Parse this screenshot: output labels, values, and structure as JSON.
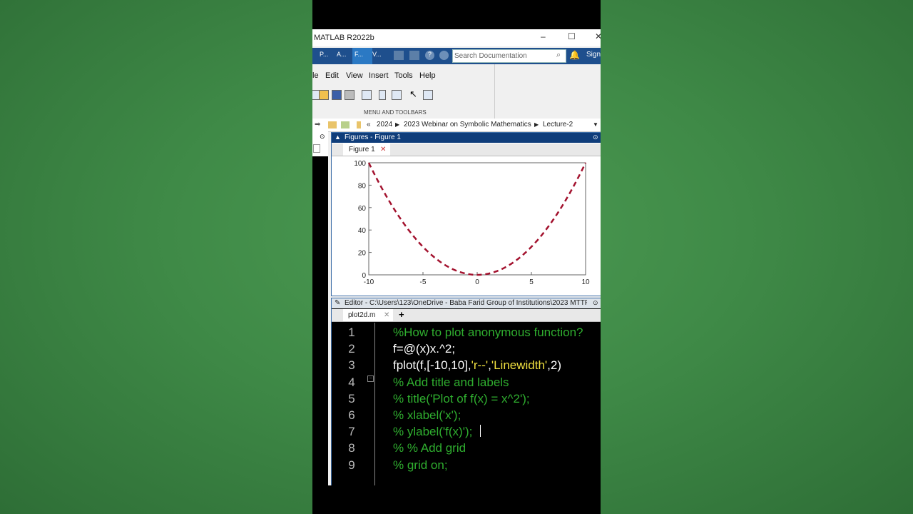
{
  "window": {
    "title": "MATLAB R2022b",
    "controls": {
      "minimize": "–",
      "maximize": "☐",
      "close": "✕"
    }
  },
  "ribbon": {
    "tabs": [
      "P...",
      "A...",
      "F...",
      "V..."
    ],
    "search_placeholder": "Search Documentation",
    "sign_in": "Sign"
  },
  "menu": {
    "items": [
      "le",
      "Edit",
      "View",
      "Insert",
      "Tools",
      "Help"
    ],
    "section_label": "MENU AND TOOLBARS"
  },
  "address": {
    "back": "«",
    "crumbs": [
      "2024",
      "2023 Webinar on Symbolic Mathematics",
      "Lecture-2"
    ]
  },
  "figure_panel": {
    "header": "Figures - Figure 1",
    "tab": "Figure 1"
  },
  "chart_data": {
    "type": "line",
    "function": "x.^2",
    "x_range": [
      -10,
      10
    ],
    "ylim": [
      0,
      100
    ],
    "xticks": [
      "-10",
      "-5",
      "0",
      "5",
      "10"
    ],
    "yticks": [
      "0",
      "20",
      "40",
      "60",
      "80",
      "100"
    ],
    "line_style": "dashed",
    "color": "#a3122e",
    "title": "",
    "xlabel": "",
    "ylabel": ""
  },
  "editor": {
    "header": "Editor - C:\\Users\\123\\OneDrive - Baba Farid Group of Institutions\\2023 MTTF...",
    "tab": "plot2d.m",
    "add_tab": "+",
    "lines": [
      {
        "num": "1",
        "parts": [
          {
            "t": "%How to plot anonymous function?",
            "c": "cmt"
          }
        ]
      },
      {
        "num": "2",
        "parts": [
          {
            "t": "f=@(x)x.^2;",
            "c": "plain"
          }
        ]
      },
      {
        "num": "3",
        "parts": [
          {
            "t": "fplot(f,[-10,10],",
            "c": "plain"
          },
          {
            "t": "'r--'",
            "c": "str"
          },
          {
            "t": ",",
            "c": "plain"
          },
          {
            "t": "'Linewidth'",
            "c": "str"
          },
          {
            "t": ",2)",
            "c": "plain"
          }
        ]
      },
      {
        "num": "4",
        "parts": [
          {
            "t": "% Add title and labels",
            "c": "cmt"
          }
        ]
      },
      {
        "num": "5",
        "parts": [
          {
            "t": "% title('Plot of f(x) = x^2');",
            "c": "cmt"
          }
        ]
      },
      {
        "num": "6",
        "parts": [
          {
            "t": "% xlabel('x');",
            "c": "cmt"
          }
        ]
      },
      {
        "num": "7",
        "parts": [
          {
            "t": "% ylabel('f(x)');",
            "c": "cmt"
          }
        ]
      },
      {
        "num": "8",
        "parts": [
          {
            "t": "% % Add grid",
            "c": "cmt"
          }
        ]
      },
      {
        "num": "9",
        "parts": [
          {
            "t": "% grid on;",
            "c": "cmt"
          }
        ]
      }
    ]
  }
}
